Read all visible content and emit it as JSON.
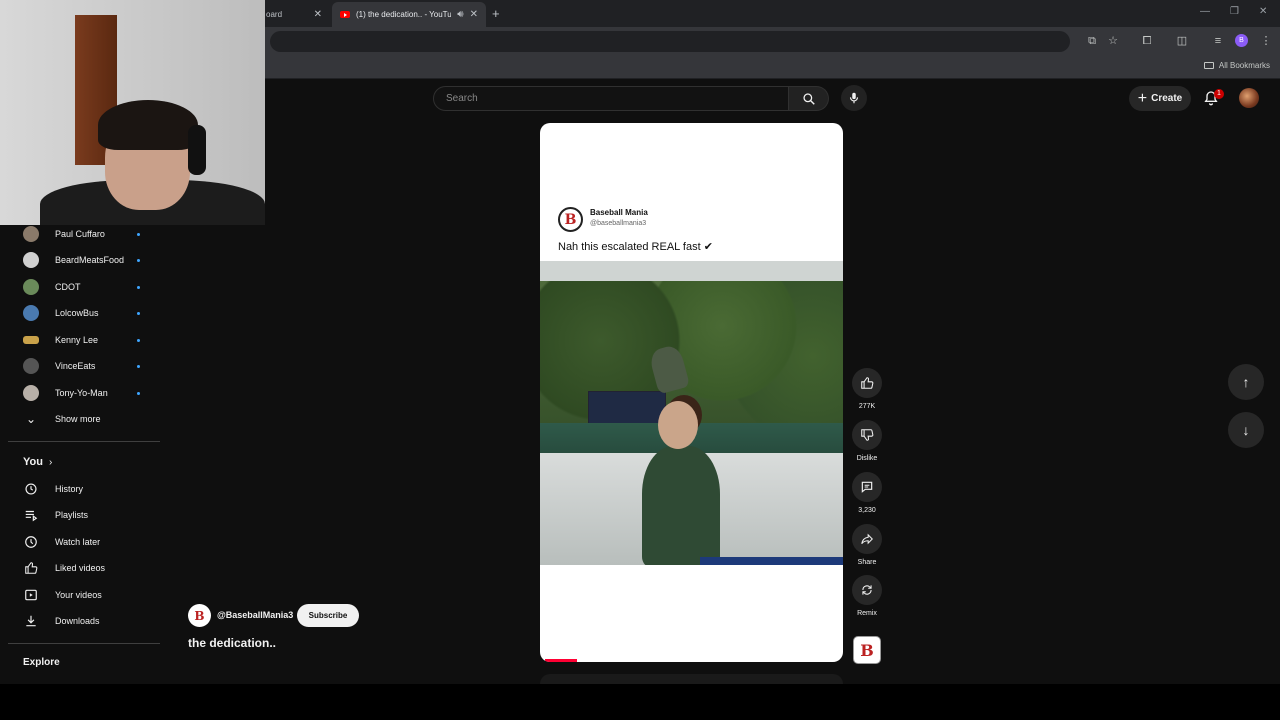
{
  "browser": {
    "tabs": [
      {
        "label": "oard"
      },
      {
        "label": "(1) the dedication.. - YouTu"
      }
    ],
    "bookmarks_label": "All Bookmarks",
    "profile_initial": "B"
  },
  "masthead": {
    "search_placeholder": "Search",
    "create_label": "Create",
    "notification_count": "1"
  },
  "sidebar": {
    "subscriptions": [
      {
        "label": "Paul Cuffaro",
        "color": "#8a7a6a"
      },
      {
        "label": "BeardMeatsFood",
        "color": "#d0d0d0"
      },
      {
        "label": "CDOT",
        "color": "#6a8a5a"
      },
      {
        "label": "LolcowBus",
        "color": "#4a7ab0"
      },
      {
        "label": "Kenny Lee",
        "color": "#c9a24a"
      },
      {
        "label": "VinceEats",
        "color": "#555555"
      },
      {
        "label": "Tony-Yo-Man",
        "color": "#b8b0a8"
      }
    ],
    "show_more": "Show more",
    "you_heading": "You",
    "you_items": [
      {
        "label": "History",
        "icon": "history-icon"
      },
      {
        "label": "Playlists",
        "icon": "playlists-icon"
      },
      {
        "label": "Watch later",
        "icon": "clock-icon"
      },
      {
        "label": "Liked videos",
        "icon": "thumb-up-icon"
      },
      {
        "label": "Your videos",
        "icon": "play-square-icon"
      },
      {
        "label": "Downloads",
        "icon": "download-icon"
      }
    ],
    "explore_heading": "Explore"
  },
  "short": {
    "post_author": "Baseball Mania",
    "post_handle": "@baseballmania3",
    "post_caption": "Nah this escalated REAL fast ✔",
    "progress_fraction": 0.11
  },
  "actions": {
    "like_count": "277K",
    "dislike_label": "Dislike",
    "comment_count": "3,230",
    "share_label": "Share",
    "remix_label": "Remix"
  },
  "channel": {
    "handle": "@BaseballMania3",
    "subscribe_label": "Subscribe",
    "video_title": "the dedication.."
  }
}
